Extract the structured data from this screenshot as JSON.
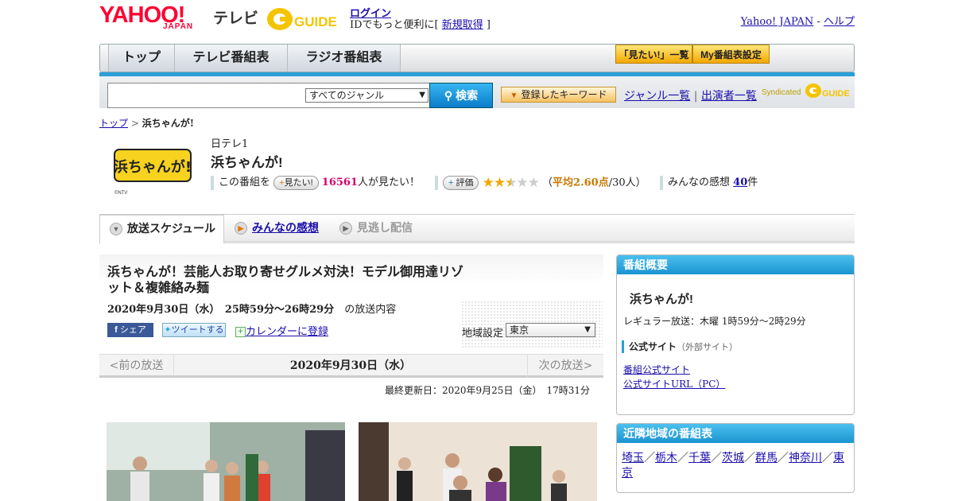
{
  "header": {
    "logo_main": "YAHOO!",
    "logo_sub": "JAPAN",
    "section": "テレビ",
    "gguide": "G GUIDE",
    "login": "ログイン",
    "id_prefix": "IDでもっと便利に[ ",
    "register": "新規取得",
    "id_suffix": " ]",
    "yj_link": "Yahoo! JAPAN",
    "sep": " - ",
    "help": "ヘルプ"
  },
  "nav": {
    "tabs": [
      "トップ",
      "テレビ番組表",
      "ラジオ番組表"
    ],
    "want_list": "「見たい!」一覧",
    "my_settings": "My番組表設定"
  },
  "search": {
    "genre_select": "すべてのジャンル",
    "button": "検索",
    "registered_kw": "登録したキーワード",
    "genre_list": "ジャンル一覧",
    "performer_list": "出演者一覧",
    "syndicated": "Syndicated"
  },
  "breadcrumb": {
    "top": "トップ",
    "sep": " > ",
    "current": "浜ちゃんが!"
  },
  "program": {
    "thumb_text": "浜ちゃんが!",
    "thumb_credit": "©NTV",
    "channel": "日テレ1",
    "title": "浜ちゃんが!",
    "want_prefix": "この番組を",
    "want_btn": "見たい!",
    "want_count": "16561",
    "want_suffix": "人が見たい！",
    "rating_btn": "評価",
    "rating_avg_prefix": "（",
    "rating_avg": "平均2.60点",
    "rating_avg_suffix": "/30人）",
    "rating_value": 2.6,
    "impressions_label": "みんなの感想",
    "impressions_count": "40",
    "impressions_suffix": "件"
  },
  "tabs": [
    "放送スケジュール",
    "みんなの感想",
    "見逃し配信"
  ],
  "episode": {
    "title": "浜ちゃんが！芸能人お取り寄せグルメ対決！モデル御用達リゾット＆複雑絡み麺",
    "date_time": "2020年9月30日（水）　25時59分～26時29分",
    "date_suffix": "の放送内容",
    "share_fb": "シェア",
    "share_tw": "ツイートする",
    "calendar": "カレンダーに登録",
    "region_label": "地域設定",
    "region_value": "東京",
    "prev": "<前の放送",
    "current_date": "2020年9月30日（水）",
    "next": "次の放送>",
    "updated": "最終更新日：2020年9月25日（金）　17時31分"
  },
  "sidebar": {
    "overview_title": "番組概要",
    "program_name": "浜ちゃんが!",
    "regular": "レギュラー放送：木曜 1時59分～2時29分",
    "official_label": "公式サイト",
    "official_note": "（外部サイト）",
    "official_link": "番組公式サイト",
    "official_pc": "公式サイトURL（PC）",
    "nearby_title": "近隣地域の番組表",
    "regions": [
      "埼玉",
      "栃木",
      "千葉",
      "茨城",
      "群馬",
      "神奈川",
      "東京"
    ]
  }
}
